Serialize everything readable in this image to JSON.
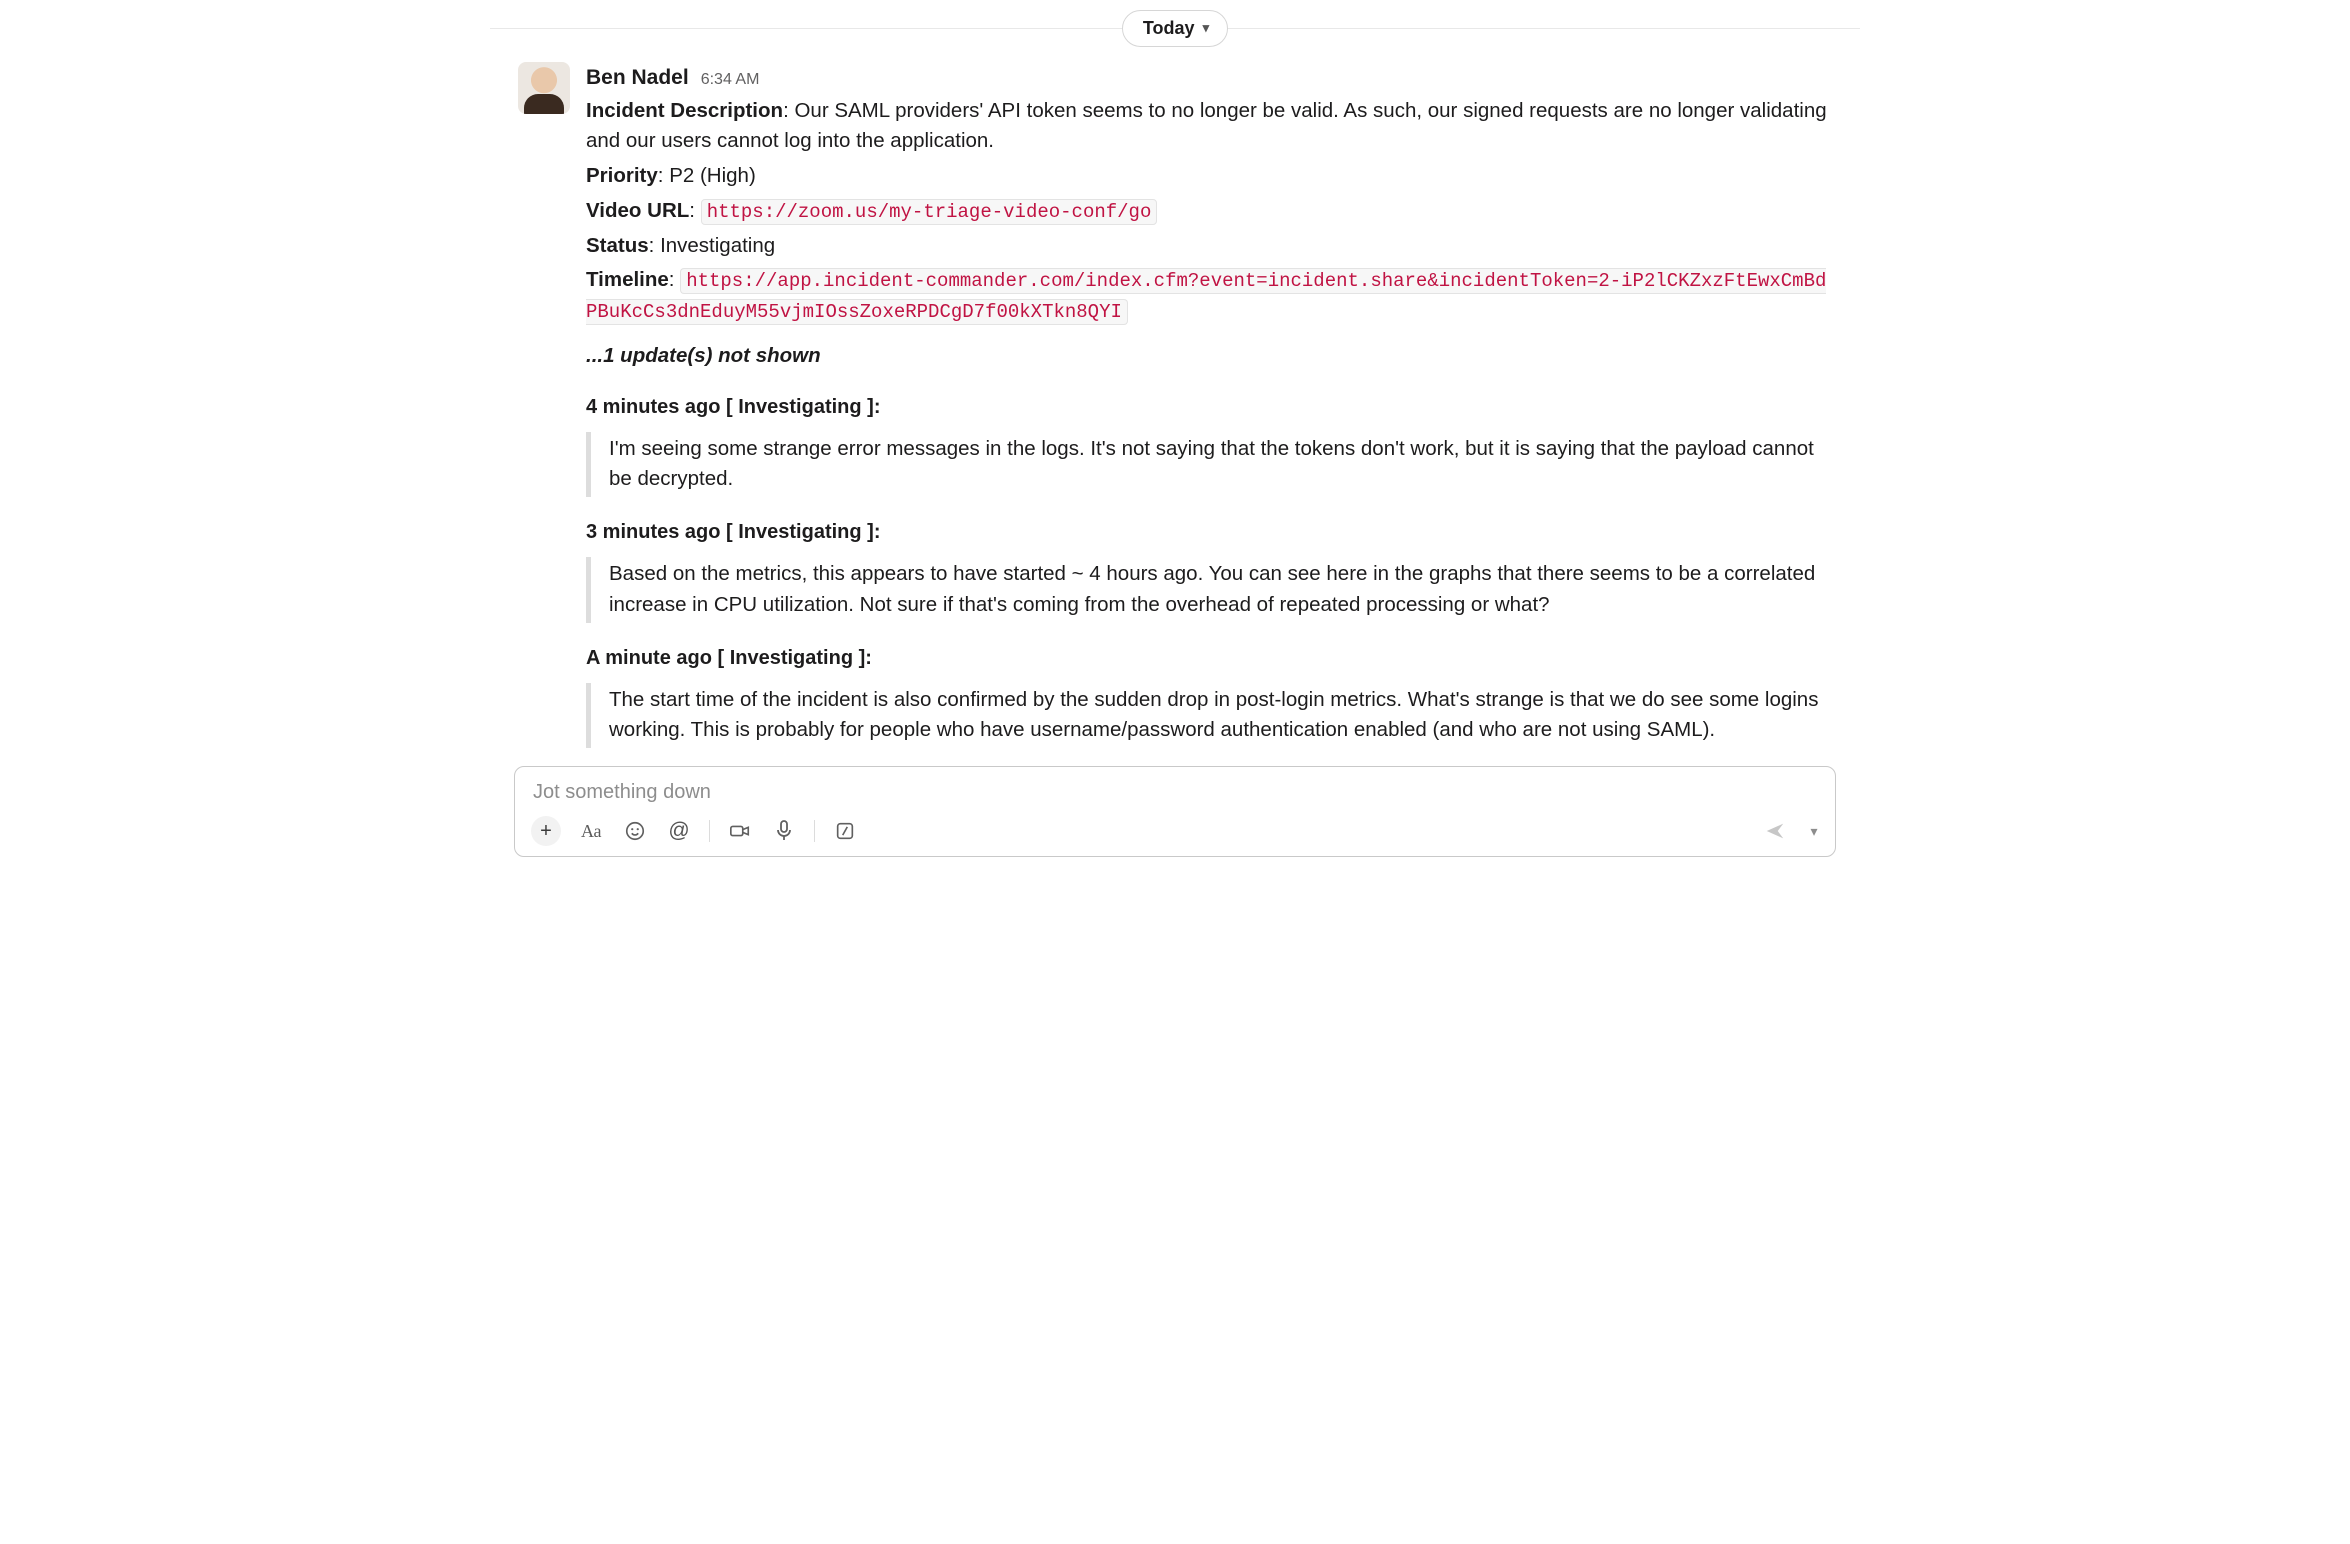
{
  "divider": {
    "label": "Today"
  },
  "message": {
    "author": "Ben Nadel",
    "time": "6:34 AM",
    "fields": {
      "description_label": "Incident Description",
      "description_value": "Our SAML providers' API token seems to no longer be valid. As such, our signed requests are no longer validating and our users cannot log into the application.",
      "priority_label": "Priority",
      "priority_value": "P2 (High)",
      "video_label": "Video URL",
      "video_url": "https://zoom.us/my-triage-video-conf/go",
      "status_label": "Status",
      "status_value": "Investigating",
      "timeline_label": "Timeline",
      "timeline_url": "https://app.incident-commander.com/index.cfm?event=incident.share&incidentToken=2-iP2lCKZxzFtEwxCmBdPBuKcCs3dnEduyM55vjmIOssZoxeRPDCgD7f00kXTkn8QYI"
    },
    "hidden_updates_text": "...1 update(s) not shown",
    "updates": [
      {
        "heading": "4 minutes ago [ Investigating ]:",
        "body": "I'm seeing some strange error messages in the logs. It's not saying that the tokens don't work, but it is saying that the payload cannot be decrypted."
      },
      {
        "heading": "3 minutes ago [ Investigating ]:",
        "body": "Based on the metrics, this appears to have started ~ 4 hours ago. You can see here in the graphs that there seems to be a correlated increase in CPU utilization. Not sure if that's coming from the overhead of repeated processing or what?"
      },
      {
        "heading": "A minute ago [ Investigating ]:",
        "body": "The start time of the incident is also confirmed by the sudden drop in post-login metrics. What's strange is that we do see some logins working. This is probably for people who have username/password authentication enabled (and who are not using SAML)."
      }
    ]
  },
  "composer": {
    "placeholder": "Jot something down"
  }
}
